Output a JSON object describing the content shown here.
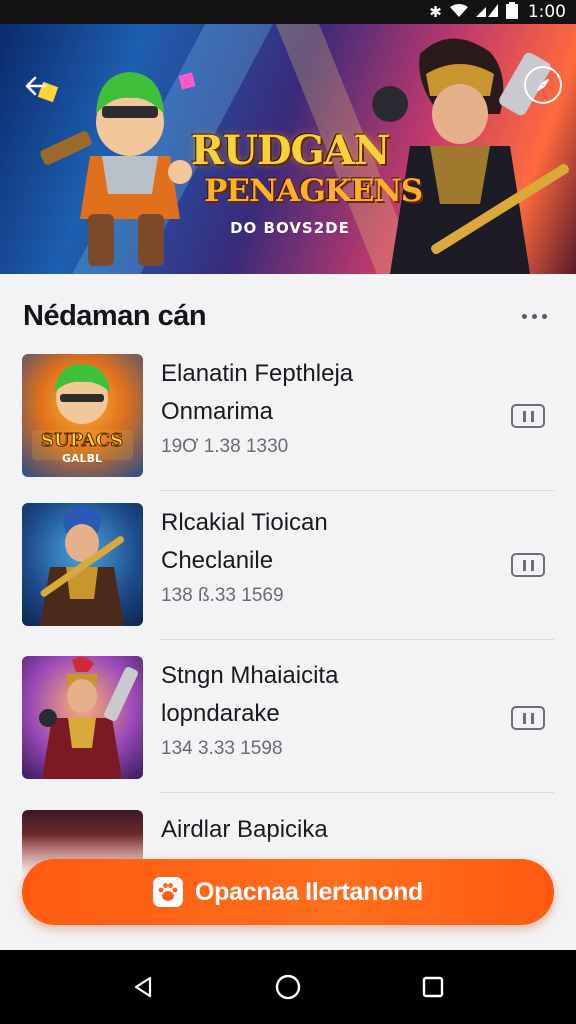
{
  "status_bar": {
    "time": "1:00",
    "icons": [
      "bluetooth-icon",
      "wifi-icon",
      "signal-icon",
      "battery-icon"
    ]
  },
  "banner": {
    "logo_line1": "RUDGAN",
    "logo_line2": "PENAGKENS",
    "logo_line3": "DO BOVS2DE",
    "back_icon": "arrow-left-icon",
    "corner_icon": "compass-icon"
  },
  "section": {
    "title": "Nédaman cán",
    "more_icon": "more-dots-icon"
  },
  "games": [
    {
      "line1": "Elanatin Fepthleja",
      "line2": "Onmarima",
      "meta": "19Ơ 1.38 1330",
      "thumb_caption": "SUPACS",
      "thumb_caption2": "GALBL",
      "button_icon": "pause-icon"
    },
    {
      "line1": "Rlcakial Tioican",
      "line2": "Checlanile",
      "meta": "138 ß.33 1569",
      "button_icon": "pause-icon"
    },
    {
      "line1": "Stngn Mhaiaicita",
      "line2": "lopndarake",
      "meta": "134 3.33 1598",
      "button_icon": "pause-icon"
    },
    {
      "line1": "Airdlar Bapicika"
    }
  ],
  "cta": {
    "label": "Opacnaa Ilertanond",
    "icon": "paw-icon"
  },
  "nav": {
    "icons": [
      "back-triangle-icon",
      "home-circle-icon",
      "recents-square-icon"
    ]
  },
  "colors": {
    "accent": "#ff5f15",
    "status_bar": "#151216",
    "nav_bar": "#000000",
    "background": "#f3f3f5"
  }
}
